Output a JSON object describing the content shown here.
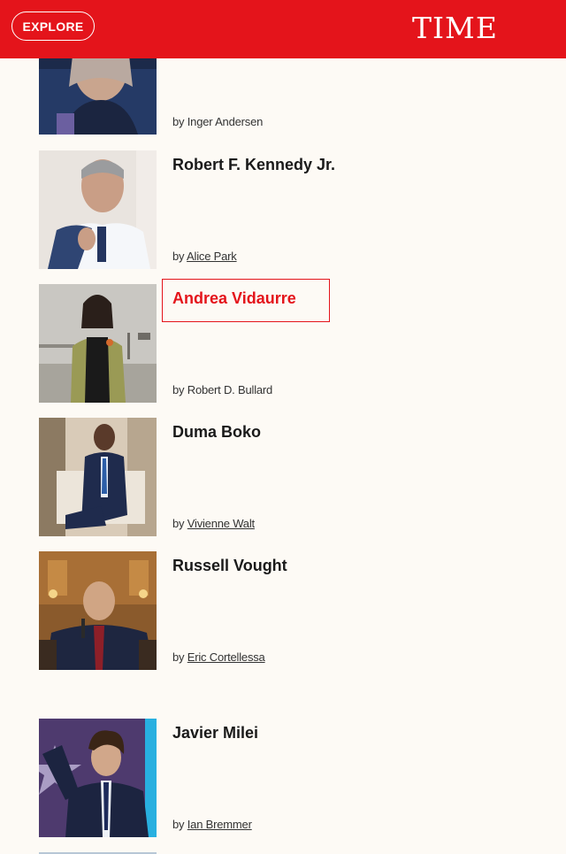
{
  "header": {
    "explore_label": "EXPLORE",
    "logo_text": "TIME",
    "color": "#e4141b"
  },
  "entries": [
    {
      "name": "",
      "by_prefix": "by",
      "author": "Inger Andersen",
      "author_linked": false
    },
    {
      "name": "Robert F. Kennedy Jr.",
      "by_prefix": "by",
      "author": "Alice Park",
      "author_linked": true
    },
    {
      "name": "Andrea Vidaurre",
      "by_prefix": "by",
      "author": "Robert D. Bullard",
      "author_linked": false,
      "active": true
    },
    {
      "name": "Duma Boko",
      "by_prefix": "by",
      "author": "Vivienne Walt",
      "author_linked": true
    },
    {
      "name": "Russell Vought",
      "by_prefix": "by",
      "author": "Eric Cortellessa",
      "author_linked": true
    },
    {
      "name": "Javier Milei",
      "by_prefix": "by",
      "author": "Ian Bremmer",
      "author_linked": true
    }
  ]
}
